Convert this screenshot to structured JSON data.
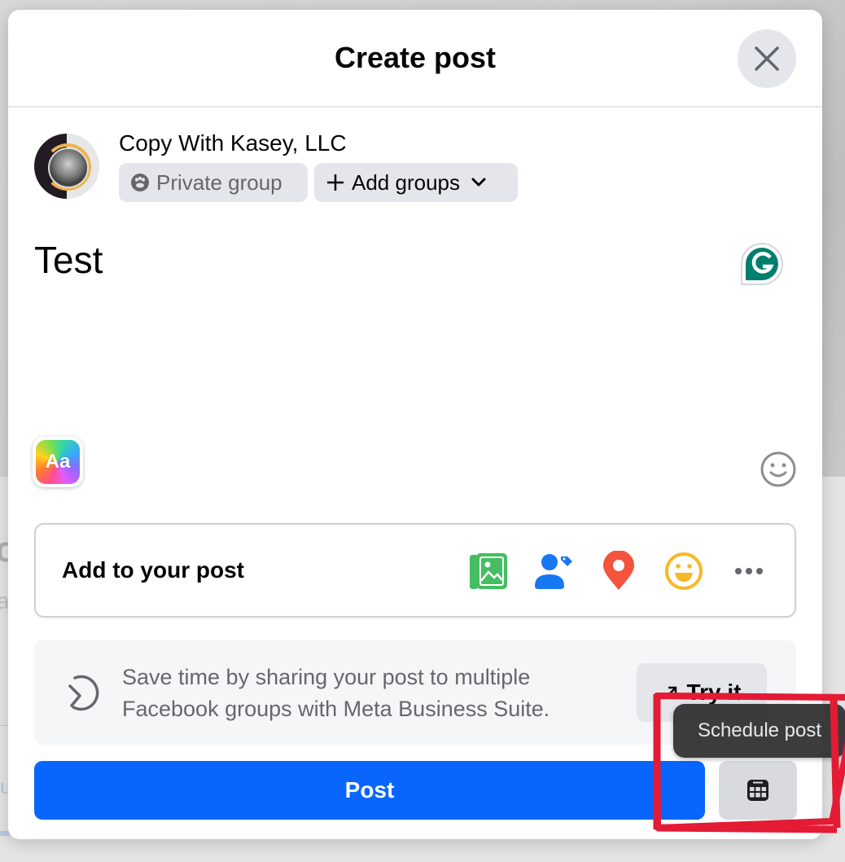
{
  "background": {
    "partial_text_1": "o",
    "partial_text_2": "a",
    "partial_text_3": "u"
  },
  "dialog": {
    "title": "Create post",
    "close_icon": "close-icon"
  },
  "author": {
    "name": "Copy With Kasey, LLC",
    "privacy_label": "Private group",
    "privacy_icon": "group-icon",
    "add_groups_label": "Add groups",
    "add_groups_icon": "plus-icon",
    "add_groups_chevron": "chevron-down-icon"
  },
  "composer": {
    "text": "Test",
    "text_format_label": "Aa",
    "grammarly_icon": "grammarly-icon",
    "emoji_icon": "smiley-icon"
  },
  "add_to_post": {
    "label": "Add to your post",
    "icons": [
      {
        "name": "photo-video-icon",
        "color": "#45bd62"
      },
      {
        "name": "tag-people-icon",
        "color": "#1877f2"
      },
      {
        "name": "check-in-icon",
        "color": "#f5533d"
      },
      {
        "name": "feeling-activity-icon",
        "color": "#f7b928"
      },
      {
        "name": "more-icon",
        "color": "#65676b"
      }
    ]
  },
  "promo": {
    "text": "Save time by sharing your post to multiple Facebook groups with Meta Business Suite.",
    "button_label": "Try it",
    "icon": "meta-business-suite-icon"
  },
  "footer": {
    "post_label": "Post",
    "schedule_icon": "calendar-icon",
    "tooltip": "Schedule post"
  },
  "colors": {
    "primary": "#0866ff",
    "annotation": "#e31b35",
    "secondary_bg": "#e4e6eb"
  }
}
